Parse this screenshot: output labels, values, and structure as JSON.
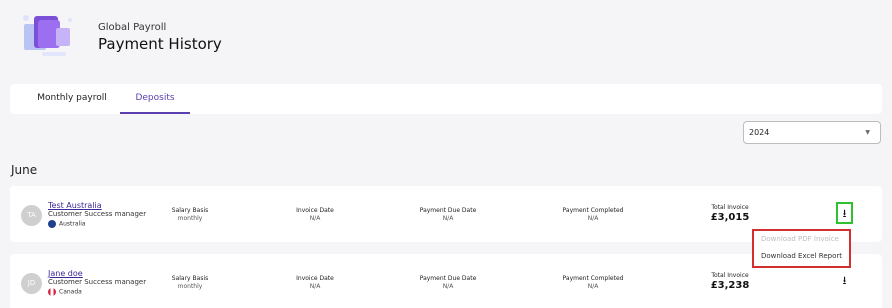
{
  "header": {
    "eyebrow": "Global Payroll",
    "title": "Payment History"
  },
  "tabs": [
    {
      "label": "Monthly payroll",
      "active": false
    },
    {
      "label": "Deposits",
      "active": true
    }
  ],
  "year_filter": {
    "value": "2024"
  },
  "month_label": "June",
  "column_labels": {
    "salary": "Salary Basis",
    "invoice_date": "Invoice Date",
    "due_date": "Payment Due Date",
    "completed": "Payment Completed",
    "total": "Total Invoice"
  },
  "rows": [
    {
      "initials": "TA",
      "name": "Test Australia",
      "role": "Customer Success manager",
      "country": "Australia",
      "salary_basis": "monthly",
      "invoice_date": "N/A",
      "due_date": "N/A",
      "completed": "N/A",
      "total": "£3,015"
    },
    {
      "initials": "JD",
      "name": "Jane doe",
      "role": "Customer Success manager",
      "country": "Canada",
      "salary_basis": "monthly",
      "invoice_date": "N/A",
      "due_date": "N/A",
      "completed": "N/A",
      "total": "£3,238"
    }
  ],
  "download_menu": {
    "items": [
      {
        "label": "Download PDF Invoice",
        "enabled": false
      },
      {
        "label": "Download Excel Report",
        "enabled": true
      }
    ]
  },
  "colors": {
    "accent": "#5b3fb0",
    "highlight_green": "#2fc12f",
    "highlight_red": "#d32f2f"
  },
  "icons": {
    "download": "download-icon",
    "caret": "caret-down-icon"
  }
}
